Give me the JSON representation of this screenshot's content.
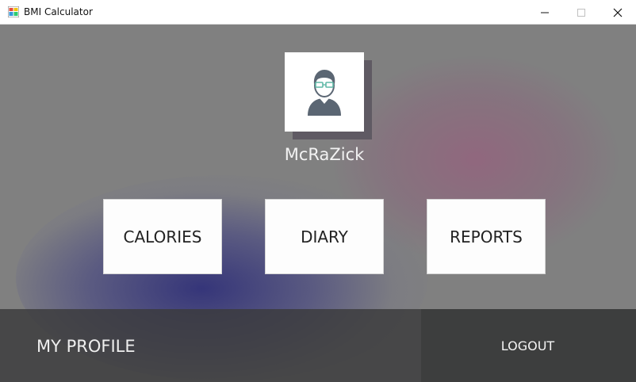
{
  "window": {
    "title": "BMI Calculator",
    "icons": {
      "app": "bmi-app-icon",
      "minimize": "minimize-icon",
      "maximize": "maximize-icon",
      "close": "close-icon"
    }
  },
  "profile": {
    "avatar_icon": "user-avatar-icon",
    "username": "McRaZick"
  },
  "tiles": {
    "calories": "CALORIES",
    "diary": "DIARY",
    "reports": "REPORTS"
  },
  "footer": {
    "my_profile": "MY PROFILE",
    "logout": "LOGOUT"
  },
  "colors": {
    "avatar_fill": "#5b6673",
    "background": "#808080",
    "footer_dark": "#3d3e3e"
  }
}
